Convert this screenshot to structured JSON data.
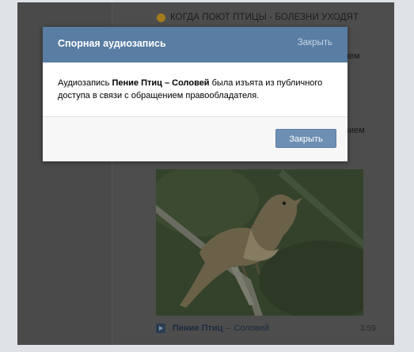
{
  "post": {
    "title": "КОГДА ПОЮТ ПТИЦЫ - БОЛЕЗНИ УХОДЯТ",
    "behind_fragments": [
      "чем",
      "вием"
    ]
  },
  "audio": {
    "title": "Пение Птиц",
    "separator": "–",
    "artist": "Соловей",
    "duration": "3:59"
  },
  "modal": {
    "title": "Спорная аудиозапись",
    "close_link": "Закрыть",
    "message": {
      "prefix": "Аудиозапись ",
      "track": "Пение Птиц – Соловей",
      "suffix": " была изъята из публичного доступа в связи с обращением правообладателя."
    },
    "button_label": "Закрыть"
  },
  "icons": {
    "post_emoji": "emoji-icon",
    "audio_play": "play-icon"
  },
  "colors": {
    "header_bg": "#597da3",
    "button_bg": "#6d8fb3",
    "overlay": "#4d4d4d"
  }
}
